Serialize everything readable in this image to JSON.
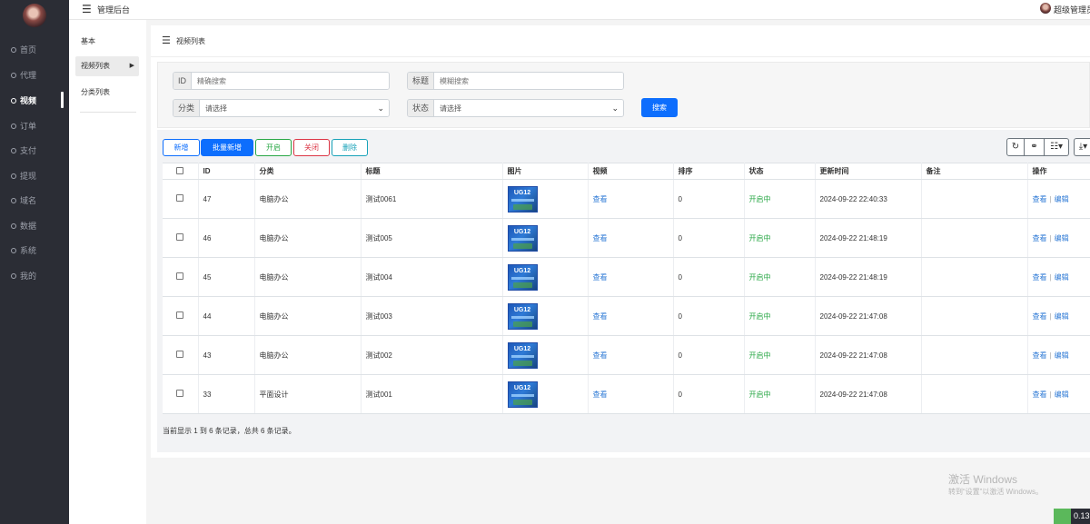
{
  "sidebar": {
    "items": [
      {
        "label": "首页",
        "active": false
      },
      {
        "label": "代理",
        "active": false
      },
      {
        "label": "视频",
        "active": true
      },
      {
        "label": "订单",
        "active": false
      },
      {
        "label": "支付",
        "active": false
      },
      {
        "label": "提现",
        "active": false
      },
      {
        "label": "域名",
        "active": false
      },
      {
        "label": "数据",
        "active": false
      },
      {
        "label": "系统",
        "active": false
      },
      {
        "label": "我的",
        "active": false
      }
    ]
  },
  "header": {
    "title": "管理后台",
    "user_name": "超级管理员"
  },
  "subnav": {
    "items": [
      {
        "label": "基本",
        "active": false
      },
      {
        "label": "视频列表",
        "active": true
      },
      {
        "label": "分类列表",
        "active": false
      }
    ]
  },
  "panel": {
    "title": "视频列表"
  },
  "search": {
    "id_label": "ID",
    "id_placeholder": "精确搜索",
    "title_label": "标题",
    "title_placeholder": "模糊搜索",
    "category_label": "分类",
    "category_value": "请选择",
    "status_label": "状态",
    "status_value": "请选择",
    "search_button": "搜索"
  },
  "toolbar": {
    "add": "新增",
    "batch_add": "批量新增",
    "open": "开启",
    "close": "关闭",
    "delete": "删除",
    "right_icons": [
      "refresh-icon",
      "toggle-view-icon",
      "columns-icon",
      "export-icon"
    ]
  },
  "table": {
    "columns": [
      "ID",
      "分类",
      "标题",
      "图片",
      "视频",
      "排序",
      "状态",
      "更新时间",
      "备注",
      "操作"
    ],
    "thumbnail_text": "UG12",
    "rows": [
      {
        "id": "47",
        "category": "电脑办公",
        "title": "测试0061",
        "video": "查看",
        "sort": "0",
        "status": "开启中",
        "updated": "2024-09-22 22:40:33",
        "remark": "",
        "view": "查看",
        "edit": "编辑"
      },
      {
        "id": "46",
        "category": "电脑办公",
        "title": "测试005",
        "video": "查看",
        "sort": "0",
        "status": "开启中",
        "updated": "2024-09-22 21:48:19",
        "remark": "",
        "view": "查看",
        "edit": "编辑"
      },
      {
        "id": "45",
        "category": "电脑办公",
        "title": "测试004",
        "video": "查看",
        "sort": "0",
        "status": "开启中",
        "updated": "2024-09-22 21:48:19",
        "remark": "",
        "view": "查看",
        "edit": "编辑"
      },
      {
        "id": "44",
        "category": "电脑办公",
        "title": "测试003",
        "video": "查看",
        "sort": "0",
        "status": "开启中",
        "updated": "2024-09-22 21:47:08",
        "remark": "",
        "view": "查看",
        "edit": "编辑"
      },
      {
        "id": "43",
        "category": "电脑办公",
        "title": "测试002",
        "video": "查看",
        "sort": "0",
        "status": "开启中",
        "updated": "2024-09-22 21:47:08",
        "remark": "",
        "view": "查看",
        "edit": "编辑"
      },
      {
        "id": "33",
        "category": "平面设计",
        "title": "测试001",
        "video": "查看",
        "sort": "0",
        "status": "开启中",
        "updated": "2024-09-22 21:47:08",
        "remark": "",
        "view": "查看",
        "edit": "编辑"
      }
    ],
    "footer": "当前显示 1 到 6 条记录，总共 6 条记录。"
  },
  "watermark": {
    "line1": "激活 Windows",
    "line2": "转到“设置”以激活 Windows。"
  },
  "corner_value": "0.13",
  "colors": {
    "sidebar_bg": "#2b2d35",
    "primary": "#0d6efd",
    "success": "#28a745",
    "danger": "#dc3545",
    "info": "#17a2b8",
    "link": "#2e7ad6"
  }
}
